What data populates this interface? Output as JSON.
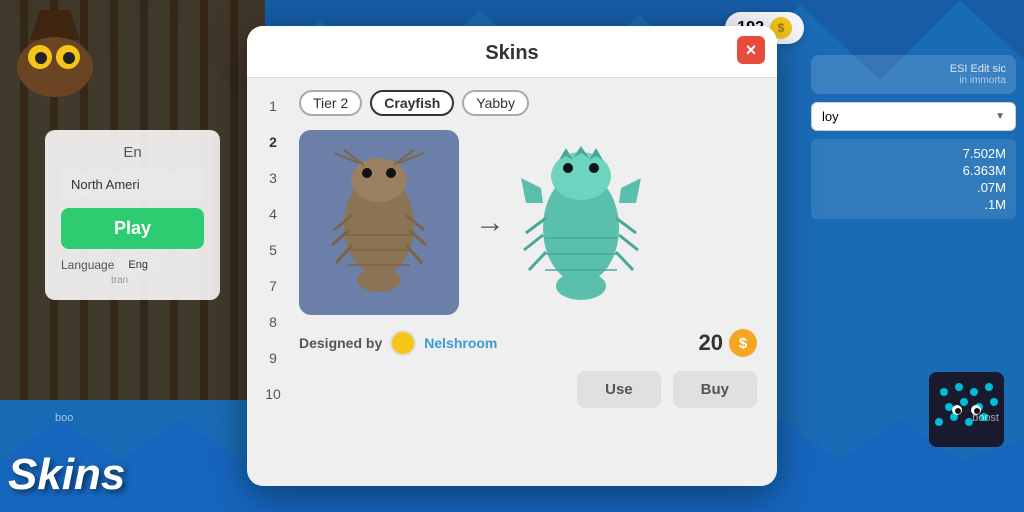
{
  "background": {
    "color": "#1a6bb5"
  },
  "header": {
    "coins": "192",
    "coin_label": "192"
  },
  "modal": {
    "title": "Skins",
    "close_label": "×",
    "tags": [
      "Tier 2",
      "Crayfish",
      "Yabby"
    ],
    "numbers": [
      "1",
      "2",
      "3",
      "4",
      "5",
      "7",
      "8",
      "9",
      "10"
    ],
    "active_number": "2",
    "skin_left_name": "Crayfish (brown)",
    "skin_right_name": "Crayfish (teal)",
    "arrow": "→",
    "designer_label": "Designed by",
    "designer_name": "Nelshroom",
    "price": "20",
    "use_button": "Use",
    "buy_button": "Buy"
  },
  "login": {
    "title": "En",
    "region": "North Ameri",
    "play_button": "Play",
    "language_label": "Language",
    "language_value": "Eng",
    "language_sub": "tran"
  },
  "right_panel": {
    "scores": [
      "7.502M",
      "6.363M",
      ".07M",
      ".1M"
    ],
    "player_select": "loy",
    "ad_text": "ESI Edit sic",
    "ad_sub": "in immorta"
  },
  "bottom": {
    "boost_left": "boo",
    "boost_right": "boost",
    "skins_text": "Skins"
  }
}
